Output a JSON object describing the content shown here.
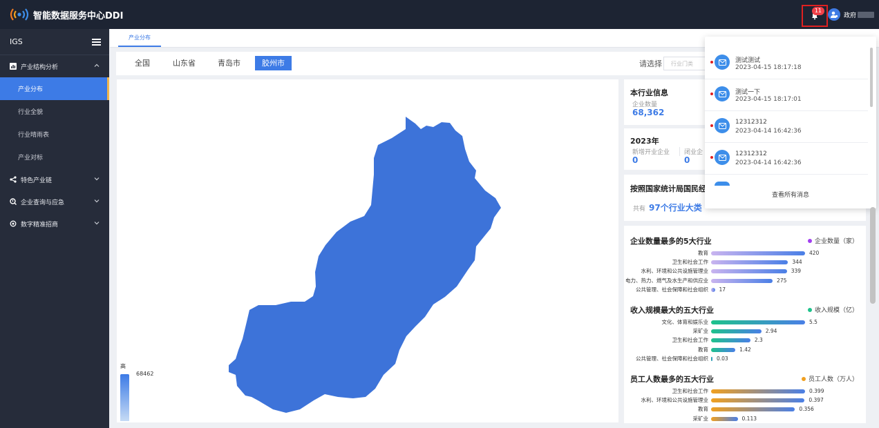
{
  "app": {
    "title": "智能数据服务中心DDI"
  },
  "header": {
    "badge_count": "11",
    "user_name": "政府"
  },
  "sidebar": {
    "title": "IGS",
    "groups": [
      {
        "label": "产业结构分析",
        "items": [
          "产业分布",
          "行业全貌",
          "行业晴雨表",
          "产业对标"
        ]
      },
      {
        "label": "特色产业链"
      },
      {
        "label": "企业查询与应急"
      },
      {
        "label": "数字精准招商"
      }
    ]
  },
  "tabs": [
    "产业分布"
  ],
  "regions": [
    "全国",
    "山东省",
    "青岛市",
    "胶州市"
  ],
  "filter": {
    "label": "请选择",
    "placeholder": "行业门类"
  },
  "map": {
    "legend_high": "高",
    "legend_value": "68462",
    "fill_color": "#3d73d9"
  },
  "info": {
    "title": "本行业信息",
    "count_label": "企业数量",
    "count_value": "68,362"
  },
  "year_card": {
    "year": "2023年",
    "new_label": "新增开业企业",
    "new_value": "0",
    "closed_label": "闭业企",
    "closed_value": "0"
  },
  "stat_card": {
    "title": "按照国家统计局国民经",
    "prefix": "共有",
    "value": "97个行业大类"
  },
  "rankings": [
    {
      "title": "企业数量最多的5大行业",
      "legend": "企业数量（家）",
      "color": "#a23ef0",
      "max": 420,
      "bar_colors": [
        "#c9b4ef",
        "#4a7fe6"
      ],
      "rows": [
        {
          "label": "教育",
          "value": 420
        },
        {
          "label": "卫生和社会工作",
          "value": 344
        },
        {
          "label": "水利、环境和公共设施管理业",
          "value": 339
        },
        {
          "label": "电力、热力、燃气及水生产和供应业",
          "value": 275
        },
        {
          "label": "公共管理、社会保障和社会组织",
          "value": 17
        }
      ]
    },
    {
      "title": "收入规模最大的五大行业",
      "legend": "收入规模（亿）",
      "color": "#1ec28b",
      "max": 5.5,
      "bar_colors": [
        "#1ec28b",
        "#4a7fe6"
      ],
      "rows": [
        {
          "label": "文化、体育和娱乐业",
          "value": 5.5
        },
        {
          "label": "采矿业",
          "value": 2.94
        },
        {
          "label": "卫生和社会工作",
          "value": 2.3
        },
        {
          "label": "教育",
          "value": 1.42
        },
        {
          "label": "公共管理、社会保障和社会组织",
          "value": 0.03
        }
      ]
    },
    {
      "title": "员工人数最多的五大行业",
      "legend": "员工人数（万人）",
      "color": "#f0a020",
      "max": 0.399,
      "bar_colors": [
        "#f0a020",
        "#4a7fe6"
      ],
      "rows": [
        {
          "label": "卫生和社会工作",
          "value": 0.399
        },
        {
          "label": "水利、环境和公共设施管理业",
          "value": 0.397
        },
        {
          "label": "教育",
          "value": 0.356
        },
        {
          "label": "采矿业",
          "value": 0.113
        }
      ]
    }
  ],
  "notifications": {
    "items": [
      {
        "title": "测试测试",
        "time": "2023-04-15 18:17:18"
      },
      {
        "title": "测试一下",
        "time": "2023-04-15 18:17:01"
      },
      {
        "title": "12312312",
        "time": "2023-04-14 16:42:36"
      },
      {
        "title": "12312312",
        "time": "2023-04-14 16:42:36"
      }
    ],
    "footer": "查看所有消息"
  }
}
